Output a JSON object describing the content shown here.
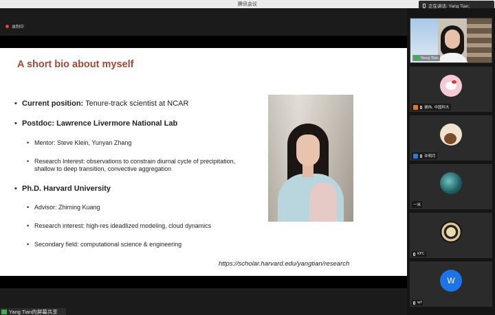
{
  "window": {
    "title": "腾讯会议"
  },
  "speaking": {
    "text": "正在讲话: Yang Tian;"
  },
  "recording": {
    "label": "录制中"
  },
  "slide": {
    "title": "A short bio about myself",
    "items": [
      {
        "label": "Current position:",
        "text": " Tenure-track scientist at NCAR"
      },
      {
        "label": "Postdoc: Lawrence Livermore National Lab",
        "text": ""
      },
      {
        "text": "Mentor: Steve Klein, Yunyan Zhang"
      },
      {
        "line1": "Research Interest: observations to constrain diurnal cycle of precipitation,",
        "line2": "shallow to deep transition, convective aggregation"
      },
      {
        "label": "Ph.D. Harvard University",
        "text": ""
      },
      {
        "text": "Advisor: Zhiming Kuang"
      },
      {
        "text": "Research interest: high-res ideadlized modeling, cloud dynamics"
      },
      {
        "text": "Secondary field: computational science & engineering"
      }
    ],
    "url": "https://scholar.harvard.edu/yangtian/research"
  },
  "share_bar": {
    "text": "Yang Tian的屏幕共享"
  },
  "participants": [
    {
      "name": "Yang Tian",
      "avatar": "video",
      "badge_color": "#3bb34a"
    },
    {
      "name": "谢伟, 中国科大",
      "avatar": "hello-kitty-avatar",
      "badge_color": "#e07a2b"
    },
    {
      "name": "许明月",
      "avatar": "cartoon-avatar",
      "badge_color": "#2f7ad8"
    },
    {
      "name": "一米",
      "avatar": "blue-pattern-avatar",
      "badge_color": ""
    },
    {
      "name": "KFC",
      "avatar": "black-pattern-avatar",
      "badge_color": ""
    },
    {
      "name": "wf",
      "avatar": "W",
      "badge_color": ""
    }
  ]
}
